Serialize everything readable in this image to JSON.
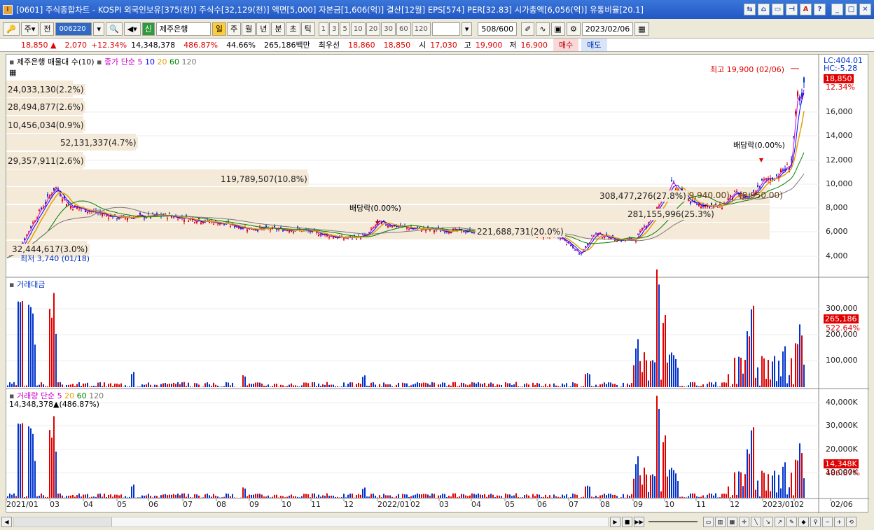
{
  "window": {
    "title": "[0601] 주식종합차트 - KOSPI 외국인보유[375(천)] 주식수[32,129(천)] 액면[5,000] 자본금[1,606(억)] 결산[12월] EPS[574] PER[32.83] 시가총액[6,056(억)] 유통비율[20.1]"
  },
  "toolbar": {
    "period_select": "주",
    "prev_label": "전",
    "code": "006220",
    "stock_name": "제주은행",
    "new_badge": "신",
    "timeframes": [
      "일",
      "주",
      "월",
      "년",
      "분",
      "초",
      "틱"
    ],
    "intervals": [
      "1",
      "3",
      "5",
      "10",
      "20",
      "30",
      "60",
      "120"
    ],
    "count_value": "508",
    "count_total": "/600",
    "date": "2023/02/06"
  },
  "quote": {
    "price": "18,850 ▲",
    "change": "2,070",
    "change_pct": "+12.34%",
    "volume": "14,348,378",
    "vol_ratio": "486.87%",
    "turnover": "44.66%",
    "amount": "265,186백만",
    "best_label": "최우선",
    "ask": "18,860",
    "bid": "18,850",
    "open_label": "시",
    "open": "17,030",
    "high_label": "고",
    "high": "19,900",
    "low_label": "저",
    "low": "16,900",
    "buy_label": "매수",
    "sell_label": "매도"
  },
  "panels": {
    "price": {
      "header_name": "제주은행 매물대 수(10)",
      "ma_label": "종가 단순",
      "ma_periods": [
        "5",
        "10",
        "20",
        "60",
        "120"
      ],
      "lc": "LC:404.01",
      "hc": "HC:-5.28",
      "last": "18,850",
      "last_pct": "12.34%",
      "high_note": "최고 19,900 (02/06)",
      "low_note": "최저 3,740 (01/18)",
      "dividend1": "배당락(0.00%)",
      "dividend2": "배당락(0.00%)",
      "scale": [
        "16,000",
        "14,000",
        "12,000",
        "10,000",
        "8,000",
        "6,000",
        "4,000"
      ]
    },
    "amount": {
      "header": "거래대금",
      "last": "265,186",
      "last_pct": "522.64%",
      "scale": [
        "300,000",
        "200,000",
        "100,000"
      ]
    },
    "volume": {
      "header": "거래량 단순",
      "ma_periods": [
        "5",
        "20",
        "60",
        "120"
      ],
      "value_note": "14,348,378▲(486.87%)",
      "last": "14,348K",
      "last_pct": "486.87%",
      "scale": [
        "40,000K",
        "30,000K",
        "20,000K",
        "10,000K"
      ]
    }
  },
  "volume_profile": [
    {
      "label": "24,033,130(2.2%)"
    },
    {
      "label": "28,494,877(2.6%)"
    },
    {
      "label": "10,456,034(0.9%)"
    },
    {
      "label": "52,131,337(4.7%)"
    },
    {
      "label": "29,357,911(2.6%)"
    },
    {
      "label": "119,789,507(10.8%)"
    },
    {
      "label": "308,477,276(27.8%)"
    },
    {
      "label": "281,155,996(25.3%)"
    },
    {
      "label": "221,688,731(20.0%)"
    },
    {
      "label": "32,444,617(3.0%)"
    }
  ],
  "price_tags": {
    "tag1": "(9,940.00)",
    "tag2": "(8,950.00)"
  },
  "xaxis": [
    "2021/01",
    "03",
    "04",
    "05",
    "06",
    "07",
    "08",
    "09",
    "10",
    "11",
    "12",
    "2022/01",
    "02",
    "03",
    "04",
    "05",
    "06",
    "07",
    "08",
    "09",
    "10",
    "11",
    "12",
    "2023/01",
    "02",
    "02/06"
  ],
  "colors": {
    "up": "#e00000",
    "down": "#0033cc",
    "ma5": "#cc00cc",
    "ma10": "#0000ff",
    "ma20": "#e0a000",
    "ma60": "#008000",
    "ma120": "#777777"
  }
}
